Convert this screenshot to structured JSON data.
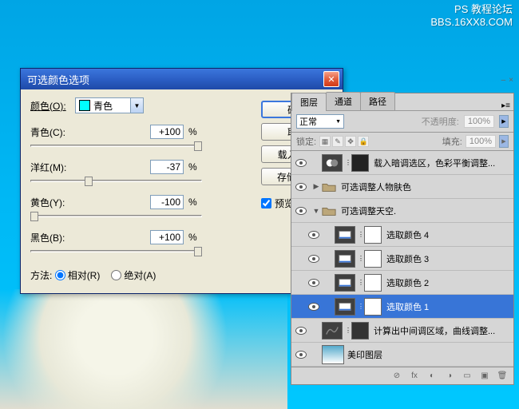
{
  "watermark": {
    "line1": "PS 教程论坛",
    "line2": "BBS.16XX8.COM"
  },
  "dialog": {
    "title": "可选颜色选项",
    "color_label": "颜色(O):",
    "color_selected": "青色",
    "sliders": {
      "cyan": {
        "label": "青色(C):",
        "value": "+100",
        "pct": "%"
      },
      "magenta": {
        "label": "洋红(M):",
        "value": "-37",
        "pct": "%"
      },
      "yellow": {
        "label": "黄色(Y):",
        "value": "-100",
        "pct": "%"
      },
      "black": {
        "label": "黑色(B):",
        "value": "+100",
        "pct": "%"
      }
    },
    "buttons": {
      "ok": "确定",
      "cancel": "取消",
      "load": "载入(L)...",
      "save": "存储(S)..."
    },
    "preview_label": "预览(P)",
    "method_label": "方法:",
    "method_relative": "相对(R)",
    "method_absolute": "绝对(A)"
  },
  "panel": {
    "tabs": {
      "layers": "图层",
      "channels": "通道",
      "paths": "路径"
    },
    "blend_mode": "正常",
    "opacity_label": "不透明度:",
    "opacity_value": "100%",
    "lock_label": "锁定:",
    "fill_label": "填充:",
    "fill_value": "100%",
    "layers": [
      {
        "name": "载入暗调选区，色彩平衡调整..."
      },
      {
        "name": "可选调整人物肤色"
      },
      {
        "name": "可选调整天空."
      },
      {
        "name": "选取颜色 4"
      },
      {
        "name": "选取颜色 3"
      },
      {
        "name": "选取颜色 2"
      },
      {
        "name": "选取颜色 1"
      },
      {
        "name": "计算出中间调区域，曲线调整..."
      },
      {
        "name": "美印图层"
      }
    ]
  }
}
